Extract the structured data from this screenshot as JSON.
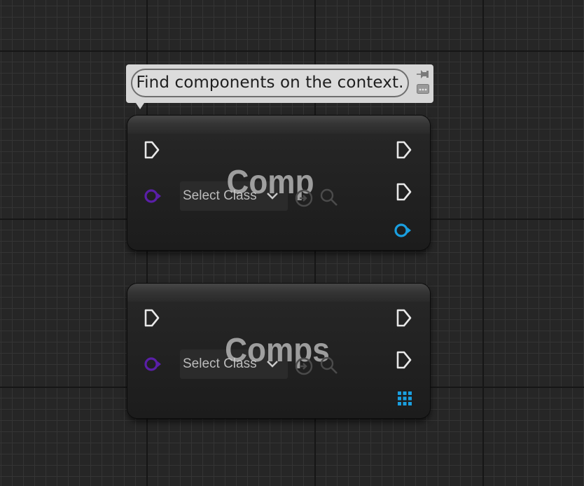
{
  "comment": {
    "text": "Find components on the context.",
    "pin_icon": "pin-icon",
    "more_icon": "ellipsis-icon"
  },
  "nodes": [
    {
      "title": "Comp",
      "class_select": {
        "value": "Select Class",
        "icon": "chevron-down-icon"
      },
      "return_pin": "object-pin",
      "colors": {
        "object_in": "#5a1fa8",
        "return": "#1a9fe0"
      }
    },
    {
      "title": "Comps",
      "class_select": {
        "value": "Select Class",
        "icon": "chevron-down-icon"
      },
      "return_pin": "array-pin",
      "colors": {
        "object_in": "#5a1fa8",
        "return": "#1a9fe0"
      }
    }
  ],
  "colors": {
    "grid_background": "#262626",
    "exec_pin": "#e8e8e8",
    "object_pin": "#5a1fa8",
    "return_pin": "#1a9fe0",
    "comment_bg": "#d6d6d6"
  }
}
